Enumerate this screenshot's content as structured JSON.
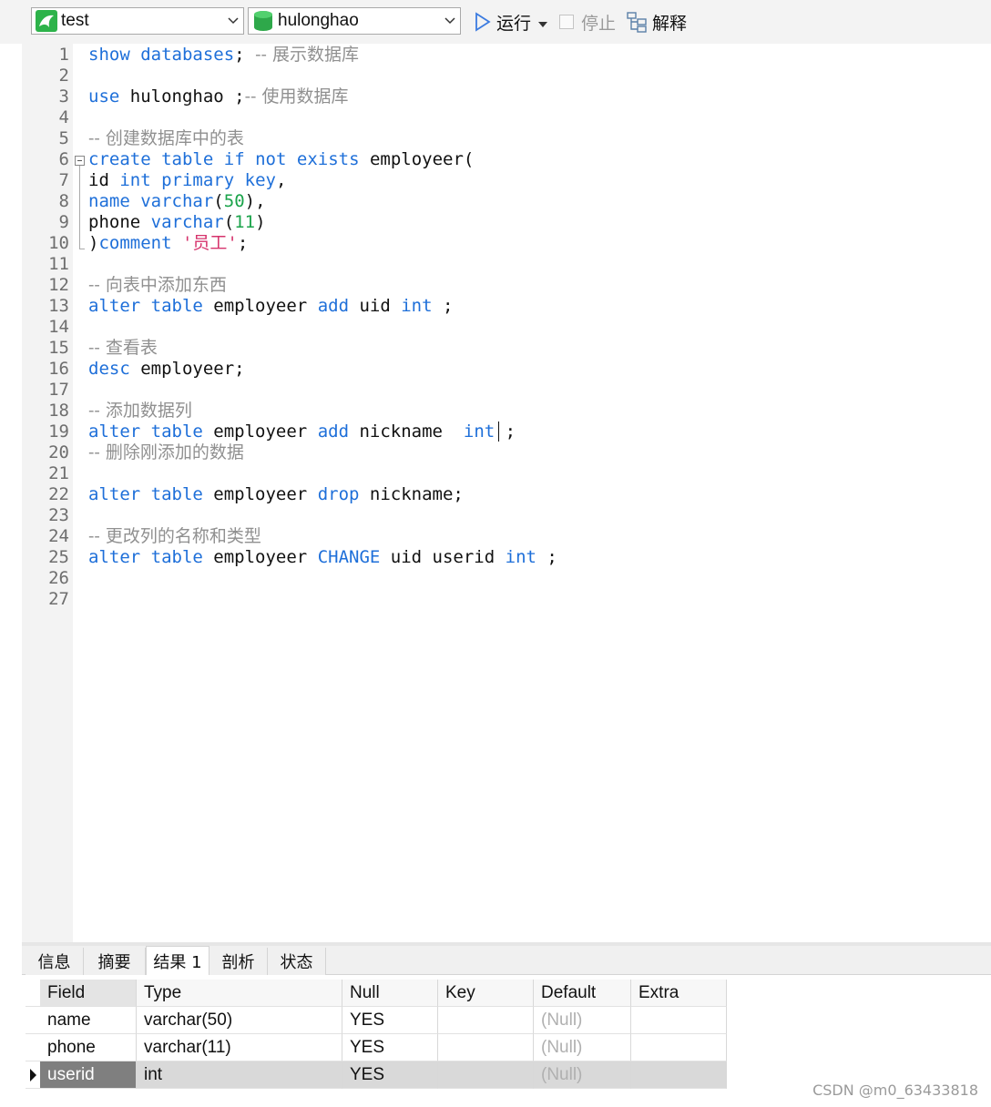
{
  "toolbar": {
    "connection": "test",
    "database": "hulonghao",
    "run_label": "运行",
    "stop_label": "停止",
    "explain_label": "解释"
  },
  "editor": {
    "lines": [
      {
        "no": "1",
        "tokens": [
          {
            "t": "show",
            "c": "k"
          },
          {
            "t": " ",
            "c": "p"
          },
          {
            "t": "databases",
            "c": "k"
          },
          {
            "t": "; ",
            "c": "p"
          },
          {
            "t": "-- 展示数据库",
            "c": "c"
          }
        ]
      },
      {
        "no": "2",
        "tokens": []
      },
      {
        "no": "3",
        "tokens": [
          {
            "t": "use",
            "c": "k"
          },
          {
            "t": " hulonghao ;",
            "c": "p"
          },
          {
            "t": "-- 使用数据库",
            "c": "c"
          }
        ]
      },
      {
        "no": "4",
        "tokens": []
      },
      {
        "no": "5",
        "tokens": [
          {
            "t": "-- 创建数据库中的表",
            "c": "c"
          }
        ]
      },
      {
        "no": "6",
        "tokens": [
          {
            "t": "create",
            "c": "k"
          },
          {
            "t": " ",
            "c": "p"
          },
          {
            "t": "table",
            "c": "k"
          },
          {
            "t": " ",
            "c": "p"
          },
          {
            "t": "if",
            "c": "k"
          },
          {
            "t": " ",
            "c": "p"
          },
          {
            "t": "not",
            "c": "k"
          },
          {
            "t": " ",
            "c": "p"
          },
          {
            "t": "exists",
            "c": "k"
          },
          {
            "t": " employeer(",
            "c": "p"
          }
        ]
      },
      {
        "no": "7",
        "tokens": [
          {
            "t": "id ",
            "c": "p"
          },
          {
            "t": "int",
            "c": "k"
          },
          {
            "t": " ",
            "c": "p"
          },
          {
            "t": "primary",
            "c": "k"
          },
          {
            "t": " ",
            "c": "p"
          },
          {
            "t": "key",
            "c": "k"
          },
          {
            "t": ",",
            "c": "p"
          }
        ]
      },
      {
        "no": "8",
        "tokens": [
          {
            "t": "name",
            "c": "k"
          },
          {
            "t": " ",
            "c": "p"
          },
          {
            "t": "varchar",
            "c": "k"
          },
          {
            "t": "(",
            "c": "p"
          },
          {
            "t": "50",
            "c": "n"
          },
          {
            "t": "),",
            "c": "p"
          }
        ]
      },
      {
        "no": "9",
        "tokens": [
          {
            "t": "phone ",
            "c": "p"
          },
          {
            "t": "varchar",
            "c": "k"
          },
          {
            "t": "(",
            "c": "p"
          },
          {
            "t": "11",
            "c": "n"
          },
          {
            "t": ")",
            "c": "p"
          }
        ]
      },
      {
        "no": "10",
        "tokens": [
          {
            "t": ")",
            "c": "p"
          },
          {
            "t": "comment",
            "c": "k"
          },
          {
            "t": " ",
            "c": "p"
          },
          {
            "t": "'员工'",
            "c": "s"
          },
          {
            "t": ";",
            "c": "p"
          }
        ]
      },
      {
        "no": "11",
        "tokens": []
      },
      {
        "no": "12",
        "tokens": [
          {
            "t": "-- 向表中添加东西",
            "c": "c"
          }
        ]
      },
      {
        "no": "13",
        "tokens": [
          {
            "t": "alter",
            "c": "k"
          },
          {
            "t": " ",
            "c": "p"
          },
          {
            "t": "table",
            "c": "k"
          },
          {
            "t": " employeer ",
            "c": "p"
          },
          {
            "t": "add",
            "c": "k"
          },
          {
            "t": " uid ",
            "c": "p"
          },
          {
            "t": "int",
            "c": "k"
          },
          {
            "t": " ;",
            "c": "p"
          }
        ]
      },
      {
        "no": "14",
        "tokens": []
      },
      {
        "no": "15",
        "tokens": [
          {
            "t": "-- 查看表",
            "c": "c"
          }
        ]
      },
      {
        "no": "16",
        "tokens": [
          {
            "t": "desc",
            "c": "k"
          },
          {
            "t": " employeer;",
            "c": "p"
          }
        ]
      },
      {
        "no": "17",
        "tokens": []
      },
      {
        "no": "18",
        "tokens": [
          {
            "t": "-- 添加数据列",
            "c": "c"
          }
        ]
      },
      {
        "no": "19",
        "tokens": [
          {
            "t": "alter",
            "c": "k"
          },
          {
            "t": " ",
            "c": "p"
          },
          {
            "t": "table",
            "c": "k"
          },
          {
            "t": " employeer ",
            "c": "p"
          },
          {
            "t": "add",
            "c": "k"
          },
          {
            "t": " nickname  ",
            "c": "p"
          },
          {
            "t": "int",
            "c": "k"
          },
          {
            "t": " ;",
            "c": "p"
          }
        ]
      },
      {
        "no": "20",
        "tokens": [
          {
            "t": "-- 删除刚添加的数据",
            "c": "c"
          }
        ]
      },
      {
        "no": "21",
        "tokens": []
      },
      {
        "no": "22",
        "tokens": [
          {
            "t": "alter",
            "c": "k"
          },
          {
            "t": " ",
            "c": "p"
          },
          {
            "t": "table",
            "c": "k"
          },
          {
            "t": " employeer ",
            "c": "p"
          },
          {
            "t": "drop",
            "c": "k"
          },
          {
            "t": " nickname;",
            "c": "p"
          }
        ]
      },
      {
        "no": "23",
        "tokens": []
      },
      {
        "no": "24",
        "tokens": [
          {
            "t": "-- 更改列的名称和类型",
            "c": "c"
          }
        ]
      },
      {
        "no": "25",
        "tokens": [
          {
            "t": "alter",
            "c": "k"
          },
          {
            "t": " ",
            "c": "p"
          },
          {
            "t": "table",
            "c": "k"
          },
          {
            "t": " employeer ",
            "c": "p"
          },
          {
            "t": "CHANGE",
            "c": "k"
          },
          {
            "t": " uid userid ",
            "c": "p"
          },
          {
            "t": "int",
            "c": "k"
          },
          {
            "t": " ;",
            "c": "p"
          }
        ]
      },
      {
        "no": "26",
        "tokens": []
      },
      {
        "no": "27",
        "tokens": []
      }
    ]
  },
  "result_tabs": [
    "信息",
    "摘要",
    "结果 1",
    "剖析",
    "状态"
  ],
  "result_active_tab": "结果 1",
  "result_grid": {
    "columns": [
      "Field",
      "Type",
      "Null",
      "Key",
      "Default",
      "Extra"
    ],
    "rows": [
      [
        "name",
        "varchar(50)",
        "YES",
        "",
        "(Null)",
        ""
      ],
      [
        "phone",
        "varchar(11)",
        "YES",
        "",
        "(Null)",
        ""
      ],
      [
        "userid",
        "int",
        "YES",
        "",
        "(Null)",
        ""
      ]
    ],
    "selected_row": 2
  },
  "watermark": "CSDN @m0_63433818",
  "colors": {
    "keyword": "#1e6fd9",
    "number": "#1aa34a",
    "string": "#d6336c",
    "comment": "#909090",
    "selected_cell": "#7f7f7f"
  }
}
